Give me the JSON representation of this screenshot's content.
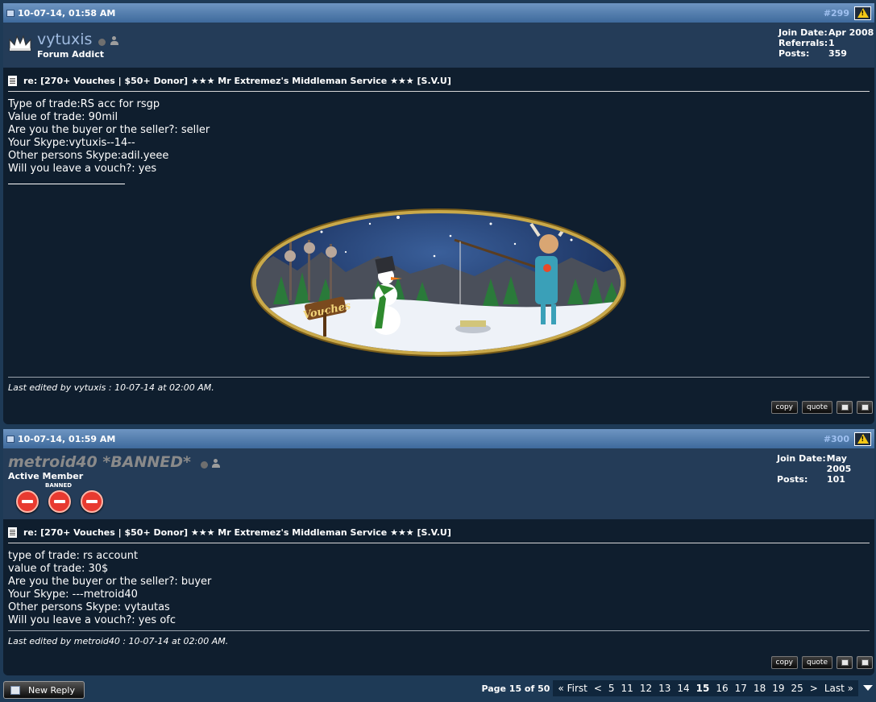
{
  "posts": [
    {
      "date": "10-07-14, 01:58 AM",
      "number": "#299",
      "username": "vytuxis",
      "rank": "Forum Addict",
      "info": [
        {
          "k": "Join Date:",
          "v": "Apr 2008"
        },
        {
          "k": "Referrals:",
          "v": "1"
        },
        {
          "k": "Posts:",
          "v": "359"
        }
      ],
      "title": "re: [270+ Vouches | $50+ Donor] ★★★ Mr Extremez's Middleman Service ★★★ [S.V.U]",
      "lines": [
        "Type of trade:RS acc for rsgp",
        "Value of trade: 90mil",
        "Are you the buyer or the seller?: seller",
        "Your Skype:vytuxis--14--",
        "Other persons Skype:adil.yeee",
        "Will you leave a vouch?: yes"
      ],
      "signature_text": "Vouches",
      "edited": "Last edited by vytuxis : 10-07-14 at 02:00 AM."
    },
    {
      "date": "10-07-14, 01:59 AM",
      "number": "#300",
      "username": "metroid40 *BANNED*",
      "rank": "Active Member",
      "banned_label": "BANNED",
      "info": [
        {
          "k": "Join Date:",
          "v": "May 2005"
        },
        {
          "k": "Posts:",
          "v": "101"
        }
      ],
      "title": "re: [270+ Vouches | $50+ Donor] ★★★ Mr Extremez's Middleman Service ★★★ [S.V.U]",
      "lines": [
        "type of trade: rs account",
        "value of trade: 30$",
        "Are you the buyer or the seller?: buyer",
        "Your Skype: ---metroid40",
        "Other persons Skype: vytautas",
        "Will you leave a vouch?: yes ofc"
      ],
      "edited": "Last edited by metroid40 : 10-07-14 at 02:00 AM."
    }
  ],
  "buttons": {
    "copy": "copy",
    "quote": "quote"
  },
  "new_reply": "New Reply",
  "pagination": {
    "label": "Page 15 of 50",
    "first": "« First",
    "prev": "<",
    "pages": [
      "5",
      "11",
      "12",
      "13",
      "14",
      "15",
      "16",
      "17",
      "18",
      "19",
      "25"
    ],
    "current": "15",
    "next": ">",
    "last": "Last »"
  },
  "colors": {
    "page_bg": "#1e3a56",
    "post_bg": "#0f1e2e",
    "header_blue": "#4f7aab",
    "post_num": "#9fc0f0",
    "banned_gray": "#8a8a8a"
  }
}
